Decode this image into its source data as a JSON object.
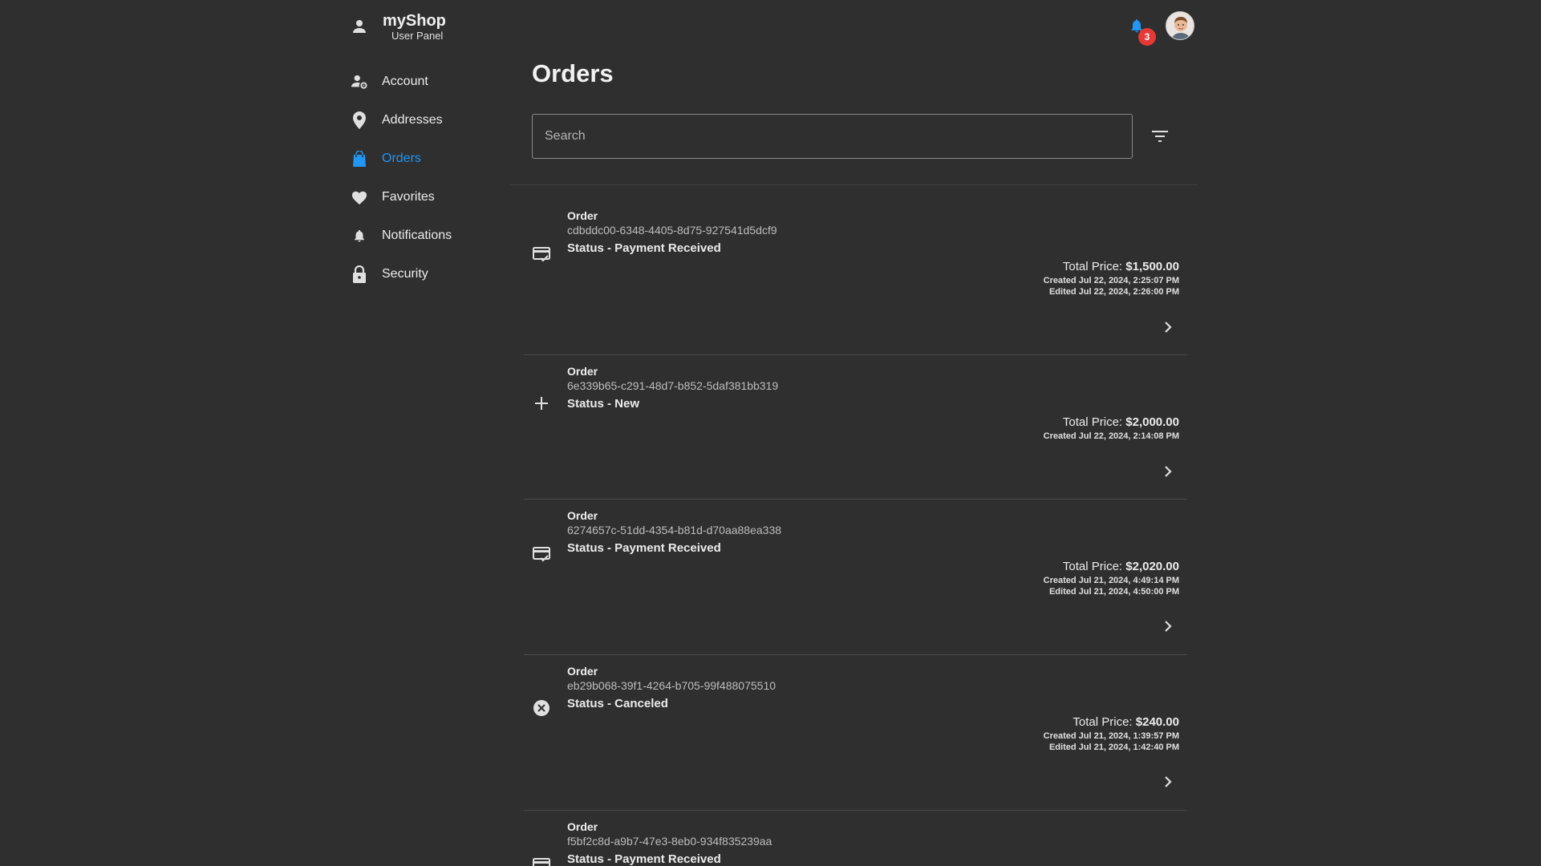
{
  "app": {
    "title": "myShop",
    "subtitle": "User Panel",
    "notification_count": "3"
  },
  "sidebar": {
    "items": [
      {
        "label": "Account",
        "icon": "account-gear-icon"
      },
      {
        "label": "Addresses",
        "icon": "map-pin-icon"
      },
      {
        "label": "Orders",
        "icon": "shopping-bag-icon",
        "active": true
      },
      {
        "label": "Favorites",
        "icon": "heart-icon"
      },
      {
        "label": "Notifications",
        "icon": "bell-icon"
      },
      {
        "label": "Security",
        "icon": "lock-icon"
      }
    ]
  },
  "main": {
    "title": "Orders",
    "search_placeholder": "Search"
  },
  "orders": [
    {
      "label": "Order",
      "id": "cdbddc00-6348-4405-8d75-927541d5dcf9",
      "status": "Status - Payment Received",
      "status_icon": "card-check-icon",
      "price_label": "Total Price: ",
      "price": "$1,500.00",
      "created": "Created Jul 22, 2024, 2:25:07 PM",
      "edited": "Edited Jul 22, 2024, 2:26:00 PM"
    },
    {
      "label": "Order",
      "id": "6e339b65-c291-48d7-b852-5daf381bb319",
      "status": "Status - New",
      "status_icon": "plus-icon",
      "price_label": "Total Price: ",
      "price": "$2,000.00",
      "created": "Created Jul 22, 2024, 2:14:08 PM",
      "edited": ""
    },
    {
      "label": "Order",
      "id": "6274657c-51dd-4354-b81d-d70aa88ea338",
      "status": "Status - Payment Received",
      "status_icon": "card-check-icon",
      "price_label": "Total Price: ",
      "price": "$2,020.00",
      "created": "Created Jul 21, 2024, 4:49:14 PM",
      "edited": "Edited Jul 21, 2024, 4:50:00 PM"
    },
    {
      "label": "Order",
      "id": "eb29b068-39f1-4264-b705-99f488075510",
      "status": "Status - Canceled",
      "status_icon": "cancel-circle-icon",
      "price_label": "Total Price: ",
      "price": "$240.00",
      "created": "Created Jul 21, 2024, 1:39:57 PM",
      "edited": "Edited Jul 21, 2024, 1:42:40 PM"
    },
    {
      "label": "Order",
      "id": "f5bf2c8d-a9b7-47e3-8eb0-934f835239aa",
      "status": "Status - Payment Received",
      "status_icon": "card-check-icon",
      "price_label": "",
      "price": "",
      "created": "",
      "edited": ""
    }
  ],
  "colors": {
    "background": "#2f2f2f",
    "accent": "#2196f3",
    "badge": "#e53935"
  }
}
